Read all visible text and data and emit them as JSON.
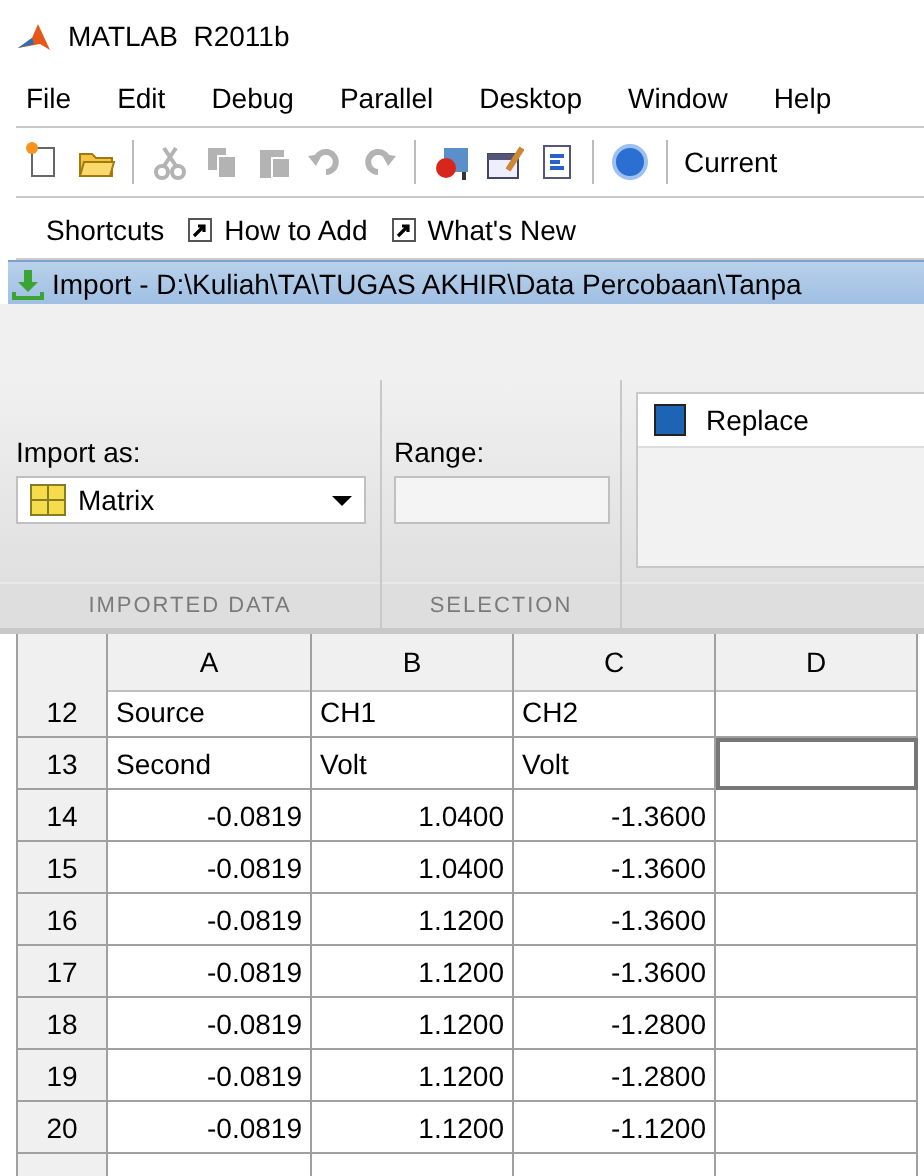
{
  "window": {
    "title": "MATLAB  R2011b"
  },
  "menu": [
    "File",
    "Edit",
    "Debug",
    "Parallel",
    "Desktop",
    "Window",
    "Help"
  ],
  "toolbar": {
    "buttons": [
      {
        "kind": "new",
        "disabled": false
      },
      {
        "kind": "open",
        "disabled": false
      },
      {
        "kind": "separator"
      },
      {
        "kind": "cut",
        "disabled": true
      },
      {
        "kind": "copy",
        "disabled": true
      },
      {
        "kind": "paste",
        "disabled": true
      },
      {
        "kind": "undo",
        "disabled": true
      },
      {
        "kind": "redo",
        "disabled": true
      },
      {
        "kind": "separator"
      },
      {
        "kind": "simulink",
        "disabled": false
      },
      {
        "kind": "guide",
        "disabled": false
      },
      {
        "kind": "profiler",
        "disabled": false
      },
      {
        "kind": "separator"
      },
      {
        "kind": "help",
        "disabled": false
      },
      {
        "kind": "separator"
      }
    ],
    "current_folder_label": "Current"
  },
  "shortcuts_bar": {
    "label": "Shortcuts",
    "links": [
      "How to Add",
      "What's New"
    ]
  },
  "import_window": {
    "title": "Import - D:\\Kuliah\\TA\\TUGAS AKHIR\\Data Percobaan\\Tanpa"
  },
  "ribbon": {
    "import_as_label": "Import as:",
    "import_as_value": "Matrix",
    "range_label": "Range:",
    "replace_label": "Replace",
    "section_labels": [
      "IMPORTED DATA",
      "SELECTION"
    ]
  },
  "table": {
    "columns": [
      "A",
      "B",
      "C",
      "D"
    ],
    "rows": [
      {
        "number": "12",
        "kind": "text",
        "cells": [
          {
            "text": "Source",
            "selected": false
          },
          {
            "text": "CH1",
            "selected": false
          },
          {
            "text": "CH2",
            "selected": false
          },
          {
            "selected": false
          }
        ]
      },
      {
        "number": "13",
        "kind": "text",
        "cells": [
          {
            "text": "Second",
            "selected": false
          },
          {
            "text": "Volt",
            "selected": false
          },
          {
            "text": "Volt",
            "selected": false
          },
          {
            "selected": true
          }
        ]
      },
      {
        "number": "14",
        "kind": "number",
        "cells": [
          {
            "text": "-0.0819",
            "selected": false
          },
          {
            "text": "1.0400",
            "selected": false
          },
          {
            "text": "-1.3600",
            "selected": false
          },
          {
            "selected": false
          }
        ]
      },
      {
        "number": "15",
        "kind": "number",
        "cells": [
          {
            "text": "-0.0819",
            "selected": false
          },
          {
            "text": "1.0400",
            "selected": false
          },
          {
            "text": "-1.3600",
            "selected": false
          },
          {
            "selected": false
          }
        ]
      },
      {
        "number": "16",
        "kind": "number",
        "cells": [
          {
            "text": "-0.0819",
            "selected": false
          },
          {
            "text": "1.1200",
            "selected": false
          },
          {
            "text": "-1.3600",
            "selected": false
          },
          {
            "selected": false
          }
        ]
      },
      {
        "number": "17",
        "kind": "number",
        "cells": [
          {
            "text": "-0.0819",
            "selected": false
          },
          {
            "text": "1.1200",
            "selected": false
          },
          {
            "text": "-1.3600",
            "selected": false
          },
          {
            "selected": false
          }
        ]
      },
      {
        "number": "18",
        "kind": "number",
        "cells": [
          {
            "text": "-0.0819",
            "selected": false
          },
          {
            "text": "1.1200",
            "selected": false
          },
          {
            "text": "-1.2800",
            "selected": false
          },
          {
            "selected": false
          }
        ]
      },
      {
        "number": "19",
        "kind": "number",
        "cells": [
          {
            "text": "-0.0819",
            "selected": false
          },
          {
            "text": "1.1200",
            "selected": false
          },
          {
            "text": "-1.2800",
            "selected": false
          },
          {
            "selected": false
          }
        ]
      },
      {
        "number": "20",
        "kind": "number",
        "cells": [
          {
            "text": "-0.0819",
            "selected": false
          },
          {
            "text": "1.1200",
            "selected": false
          },
          {
            "text": "-1.1200",
            "selected": false
          },
          {
            "selected": false
          }
        ]
      }
    ]
  }
}
